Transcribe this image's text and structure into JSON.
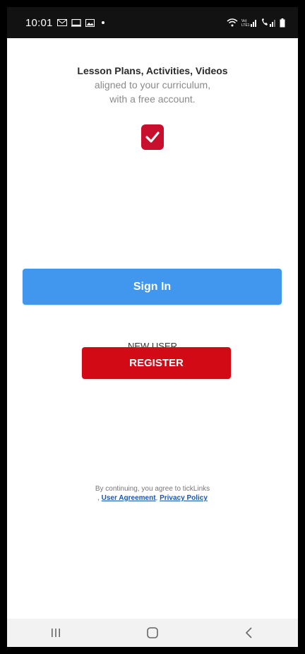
{
  "status_bar": {
    "time": "10:01",
    "icons": [
      "mail-icon",
      "screen-icon",
      "gallery-icon",
      "dot-indicator",
      "wifi-icon",
      "volte-signal-icon",
      "call-signal-icon",
      "battery-icon"
    ]
  },
  "hero": {
    "headline": "Lesson Plans, Activities, Videos",
    "subline1": "aligned to your curriculum,",
    "subline2": "with a free account."
  },
  "buttons": {
    "sign_in": "Sign In",
    "register": "REGISTER"
  },
  "new_user_label": "NEW USER",
  "legal": {
    "text": "By continuing, you agree to tickLinks",
    "prefix": ",",
    "user_agreement": "User Agreement",
    "separator": ",",
    "privacy_policy": "Privacy Policy"
  },
  "colors": {
    "sign_in_bg": "#4196ee",
    "register_bg": "#d10a16",
    "logo_bg": "#c8102e",
    "link": "#1a56b0"
  },
  "nav": {
    "icons": [
      "recent-apps-icon",
      "home-icon",
      "back-icon"
    ]
  }
}
